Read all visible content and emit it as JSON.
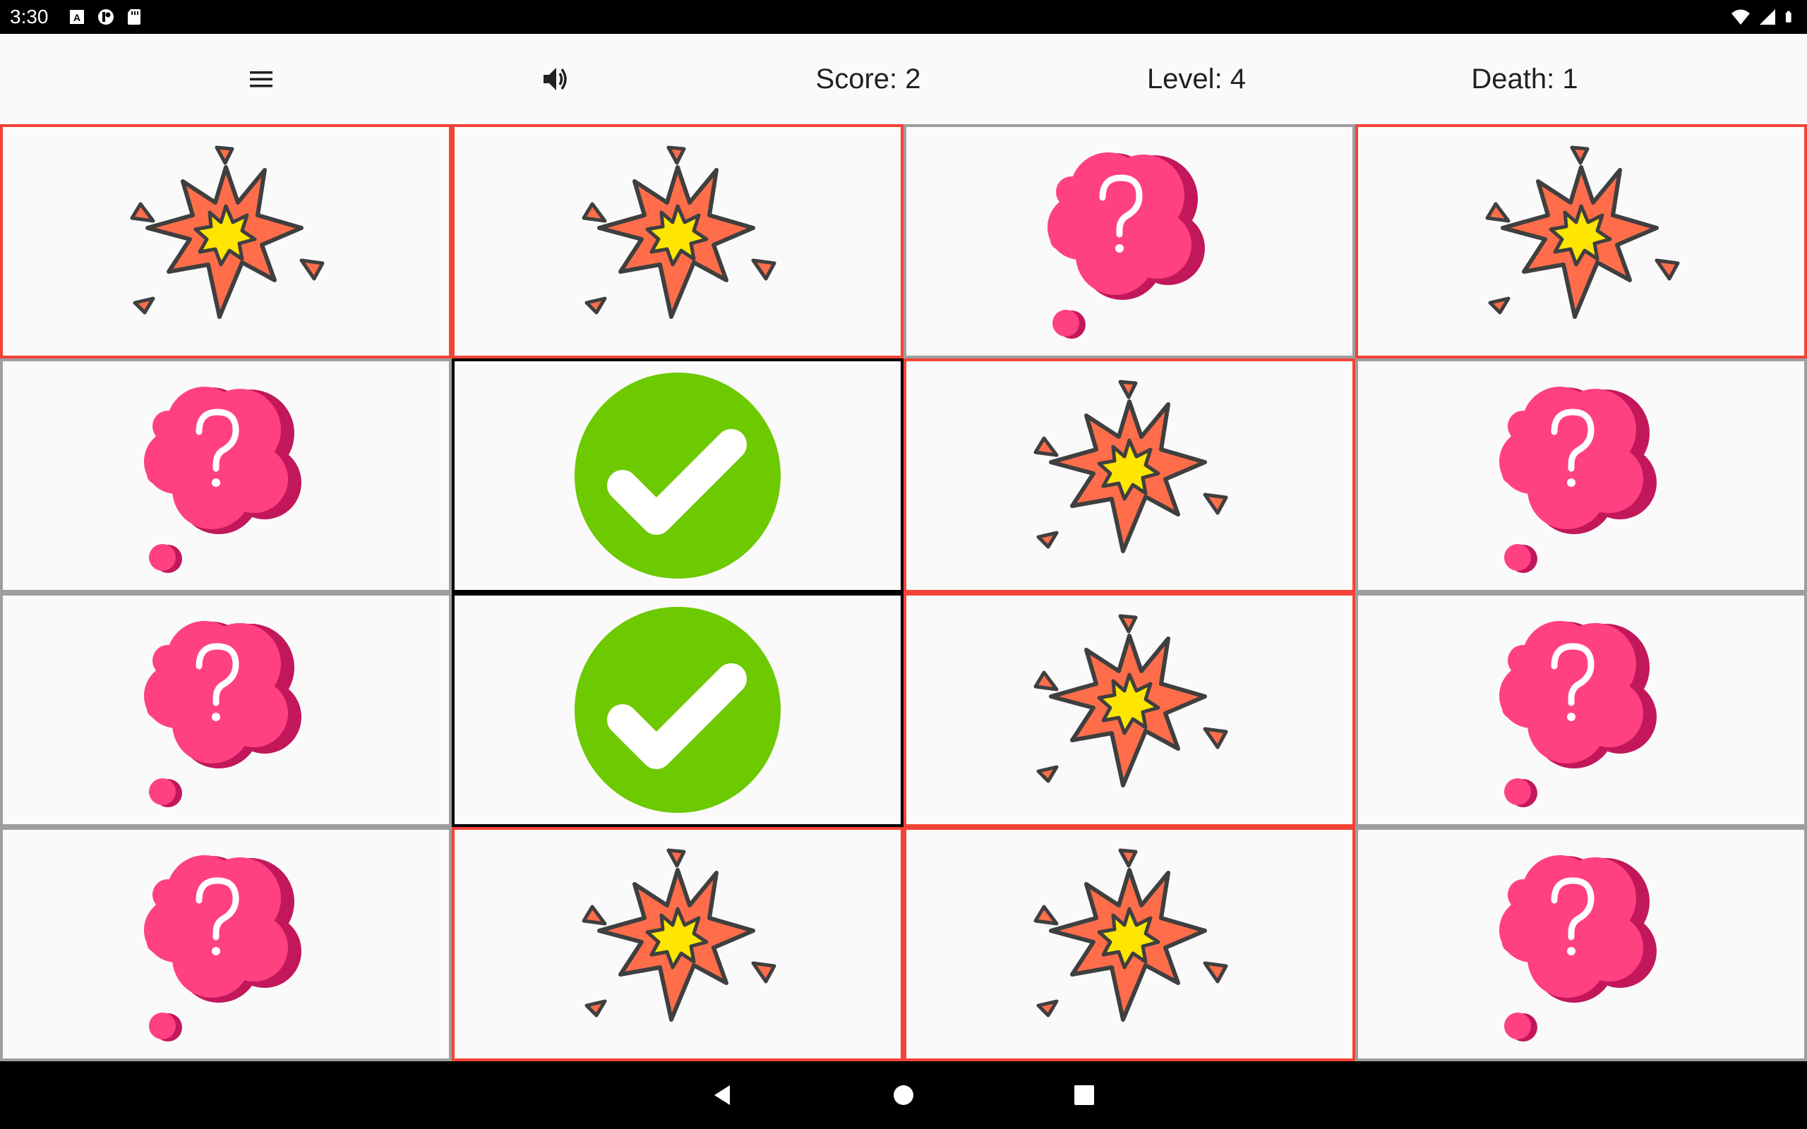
{
  "status_bar": {
    "time": "3:30",
    "left_icons": [
      "a-badge-icon",
      "sync-icon",
      "sd-card-icon"
    ],
    "right_icons": [
      "wifi-icon",
      "cell-signal-icon",
      "battery-icon"
    ]
  },
  "header": {
    "menu_icon": "hamburger-menu-icon",
    "sound_icon": "volume-icon",
    "score": "Score: 2",
    "level": "Level: 4",
    "death": "Death: 1"
  },
  "board": {
    "rows": 4,
    "cols": 4,
    "tiles": [
      [
        "bomb",
        "bomb",
        "hidden",
        "bomb"
      ],
      [
        "hidden",
        "found",
        "bomb",
        "hidden"
      ],
      [
        "hidden",
        "found",
        "bomb",
        "hidden"
      ],
      [
        "hidden",
        "bomb",
        "bomb",
        "hidden"
      ]
    ]
  },
  "colors": {
    "bomb_border": "#f44336",
    "hidden_border": "#9e9e9e",
    "found_border": "#000000",
    "question_bubble": "#ff4081",
    "question_shadow": "#c2185b",
    "check_green": "#6dc900",
    "explosion_orange": "#ff6d4a",
    "explosion_yellow": "#ffe600"
  },
  "nav_bar": {
    "buttons": [
      "back-icon",
      "home-icon",
      "recents-icon"
    ]
  }
}
